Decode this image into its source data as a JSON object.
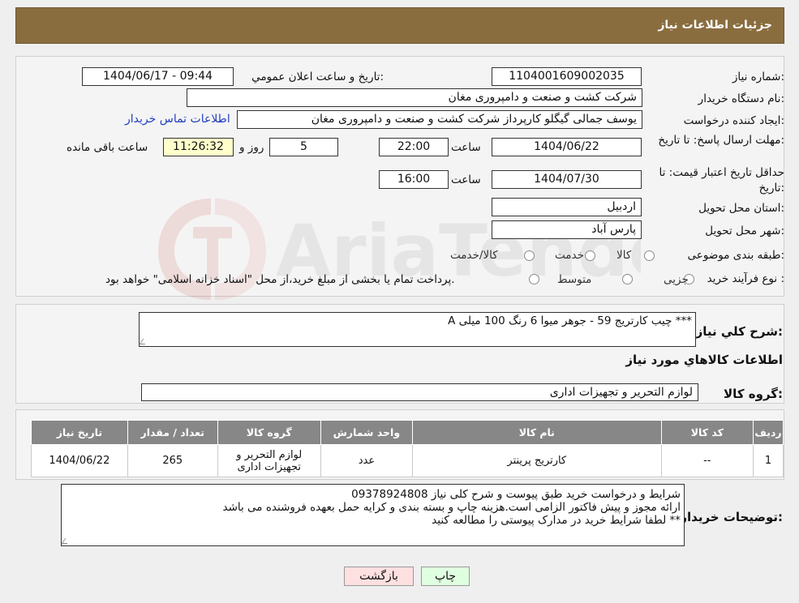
{
  "header": {
    "title": "جزئیات اطلاعات نیاز"
  },
  "form": {
    "need_number_label": "شماره نیاز:",
    "need_number": "1104001609002035",
    "announce_label": "تاریخ و ساعت اعلان عمومي:",
    "announce_value": "1404/06/17 - 09:44",
    "buyer_org_label": "نام دستگاه خریدار:",
    "buyer_org": "شرکت کشت و صنعت و دامپروری مغان",
    "creator_label": "ایجاد کننده درخواست:",
    "creator": "یوسف جمالی گیگلو کارپرداز شرکت کشت و صنعت و دامپروری مغان",
    "contact_link": "اطلاعات تماس خریدار",
    "deadline_label": "مهلت ارسال پاسخ: تا تاریخ:",
    "deadline_date": "1404/06/22",
    "time_label": "ساعت",
    "deadline_time": "22:00",
    "days_value": "5",
    "days_label": "روز و",
    "remaining_time": "11:26:32",
    "remaining_label": "ساعت باقی مانده",
    "min_validity_label": "حداقل تاریخ اعتبار قیمت: تا تاریخ:",
    "min_validity_date": "1404/07/30",
    "min_validity_time": "16:00",
    "province_label": "استان محل تحویل:",
    "province": "اردبیل",
    "city_label": "شهر محل تحویل:",
    "city": "پارس آباد",
    "category_label": "طبقه بندی موضوعی:",
    "category_options": [
      "کالا",
      "خدمت",
      "کالا/خدمت"
    ],
    "process_label": "نوع فرآیند خرید :",
    "process_options": [
      "جزیی",
      "متوسط"
    ],
    "process_note": "پرداخت تمام یا بخشی از مبلغ خرید،از محل \"اسناد خزانه اسلامی\" خواهد بود."
  },
  "summary": {
    "desc_label": "شرح کلي نیاز:",
    "desc_value": "A چیب کارتریج 59 - جوهر میوا 6 رنگ 100 میلی ***",
    "goods_info_title": "اطلاعات کالاهاي مورد نیاز",
    "goods_group_label": "گروه کالا:",
    "goods_group_value": "لوازم التحریر و تجهیزات اداری"
  },
  "table": {
    "headers": [
      "ردیف",
      "کد کالا",
      "نام کالا",
      "واحد شمارش",
      "گروه کالا",
      "تعداد / مقدار",
      "تاریخ نیاز"
    ],
    "rows": [
      [
        "1",
        "--",
        "کارتریج پرینتر",
        "عدد",
        "لوازم التحریر و تجهیزات اداری",
        "265",
        "1404/06/22"
      ]
    ]
  },
  "notes": {
    "label": "توضیحات خریدار:",
    "lines": [
      "شرایط و درخواست خرید طبق پیوست و شرح کلی نیاز 09378924808",
      "ارائه مجوز و پیش فاکتور الزامی است.هزینه چاپ و بسته بندی و کرایه حمل بعهده فروشنده می باشد",
      "لطفا شرایط خرید در مدارک پیوستی را مطالعه کنید **"
    ]
  },
  "buttons": {
    "print": "چاپ",
    "back": "بازگشت"
  },
  "watermark": {
    "text": "AriaTender.neT"
  },
  "colors": {
    "header_bg": "#8a6d3f",
    "table_header": "#878787",
    "link": "#1f3fbf",
    "back_button_bg": "#ffe0e0",
    "print_button_bg": "#e0ffe0",
    "remaining_bg": "#ffffcc"
  }
}
